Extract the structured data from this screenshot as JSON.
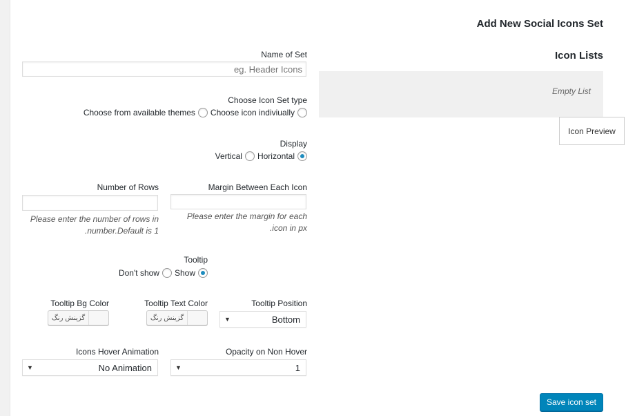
{
  "header": {
    "title": "Add New Social Icons Set"
  },
  "form": {
    "name_of_set": {
      "label": "Name of Set",
      "placeholder": "eg. Header Icons"
    },
    "icon_set_type": {
      "label": "Choose Icon Set type",
      "option_themes": "Choose from available themes",
      "option_individual": "Choose icon indiviually"
    },
    "display": {
      "label": "Display",
      "option_vertical": "Vertical",
      "option_horizontal": "Horizontal",
      "selected": "Horizontal"
    },
    "number_of_rows": {
      "label": "Number of Rows",
      "value": "",
      "help": "Please enter the number of rows in number.Default is 1."
    },
    "margin": {
      "label": "Margin Between Each Icon",
      "value": "",
      "help": "Please enter the margin for each icon in px."
    },
    "tooltip": {
      "label": "Tooltip",
      "option_dont_show": "Don't show",
      "option_show": "Show",
      "selected": "Show"
    },
    "tooltip_bg_color": {
      "label": "Tooltip Bg Color",
      "button": "گزینش رنگ"
    },
    "tooltip_text_color": {
      "label": "Tooltip Text Color",
      "button": "گزینش رنگ"
    },
    "tooltip_position": {
      "label": "Tooltip Position",
      "value": "Bottom"
    },
    "hover_animation": {
      "label": "Icons Hover Animation",
      "value": "No Animation"
    },
    "opacity": {
      "label": "Opacity on Non Hover",
      "value": "1"
    }
  },
  "icon_lists": {
    "title": "Icon Lists",
    "empty_text": "Empty List"
  },
  "icon_preview": {
    "label": "Icon Preview"
  },
  "save_button": {
    "label": "Save icon set"
  },
  "colors": {
    "accent": "#0085ba",
    "radio_dot": "#1e8cbe"
  }
}
